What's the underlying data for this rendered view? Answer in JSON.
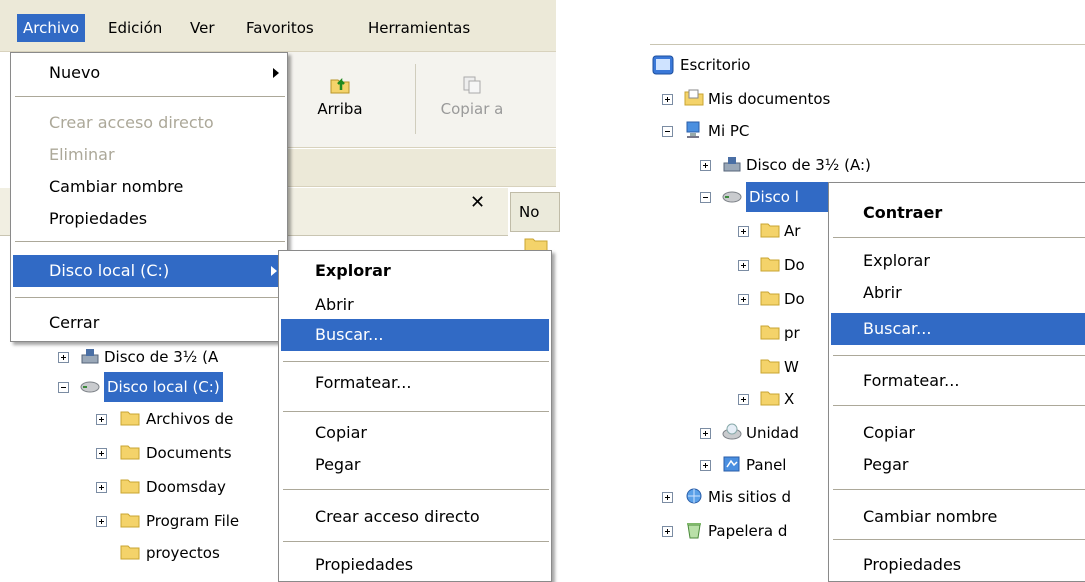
{
  "menubar": {
    "items": [
      "Archivo",
      "Edición",
      "Ver",
      "Favoritos",
      "Herramientas"
    ]
  },
  "toolbar": {
    "up_label": "Arriba",
    "copy_label": "Copiar a"
  },
  "file_menu": {
    "items": [
      "Nuevo",
      "Crear acceso directo",
      "Eliminar",
      "Cambiar nombre",
      "Propiedades",
      "Disco local (C:)",
      "Cerrar"
    ]
  },
  "left_context_menu": {
    "items": [
      "Explorar",
      "Abrir",
      "Buscar...",
      "Formatear...",
      "Copiar",
      "Pegar",
      "Crear acceso directo",
      "Propiedades"
    ]
  },
  "left_tree": {
    "items": [
      "Disco de 3½ (A",
      "Disco local (C:)",
      "Archivos de",
      "Documents",
      "Doomsday",
      "Program File",
      "proyectos"
    ]
  },
  "right_pane": {
    "header_col": "No"
  },
  "right_tree": {
    "items": [
      "Escritorio",
      "Mis documentos",
      "Mi PC",
      "Disco de 3½ (A:)",
      "Disco l",
      "Ar",
      "Do",
      "Do",
      "pr",
      "W",
      "X",
      "Unidad",
      "Panel",
      "Mis sitios d",
      "Papelera d"
    ]
  },
  "right_context_menu": {
    "items": [
      "Contraer",
      "Explorar",
      "Abrir",
      "Buscar...",
      "Formatear...",
      "Copiar",
      "Pegar",
      "Cambiar nombre",
      "Propiedades"
    ]
  },
  "colors": {
    "selection": "#316ac5",
    "menubar": "#ece9d8",
    "separator": "#aca899"
  }
}
